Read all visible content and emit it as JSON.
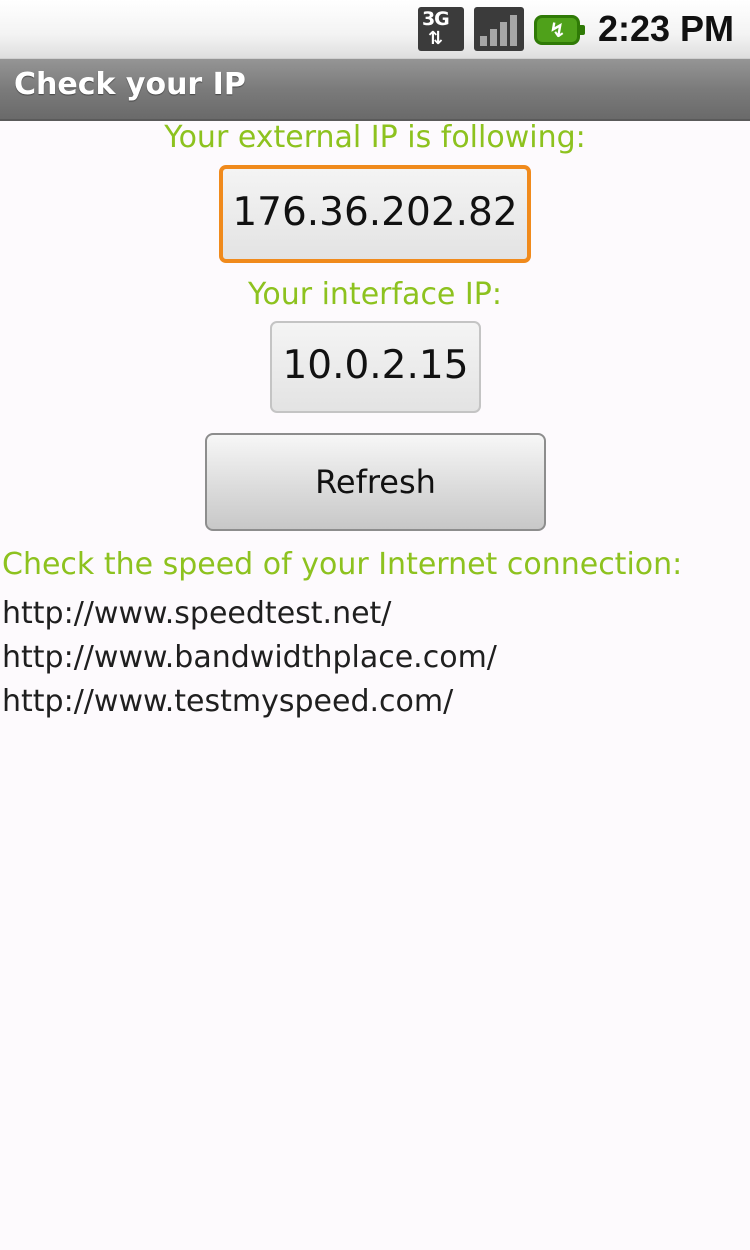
{
  "status_bar": {
    "network_type": "3G",
    "network_arrows": "⇅",
    "signal_bars": 4,
    "battery_color": "#4fa11a",
    "time": "2:23 PM"
  },
  "app": {
    "title": "Check your IP"
  },
  "main": {
    "external_ip_label": "Your external IP is following:",
    "external_ip_value": "176.36.202.82",
    "interface_ip_label": "Your interface IP:",
    "interface_ip_value": "10.0.2.15",
    "refresh_label": "Refresh",
    "speed_heading": "Check the speed of your Internet connection:",
    "speed_links": [
      "http://www.speedtest.net/",
      "http://www.bandwidthplace.com/",
      "http://www.testmyspeed.com/"
    ]
  },
  "colors": {
    "accent_green": "#8dc21f",
    "focus_orange": "#f08a1c"
  }
}
